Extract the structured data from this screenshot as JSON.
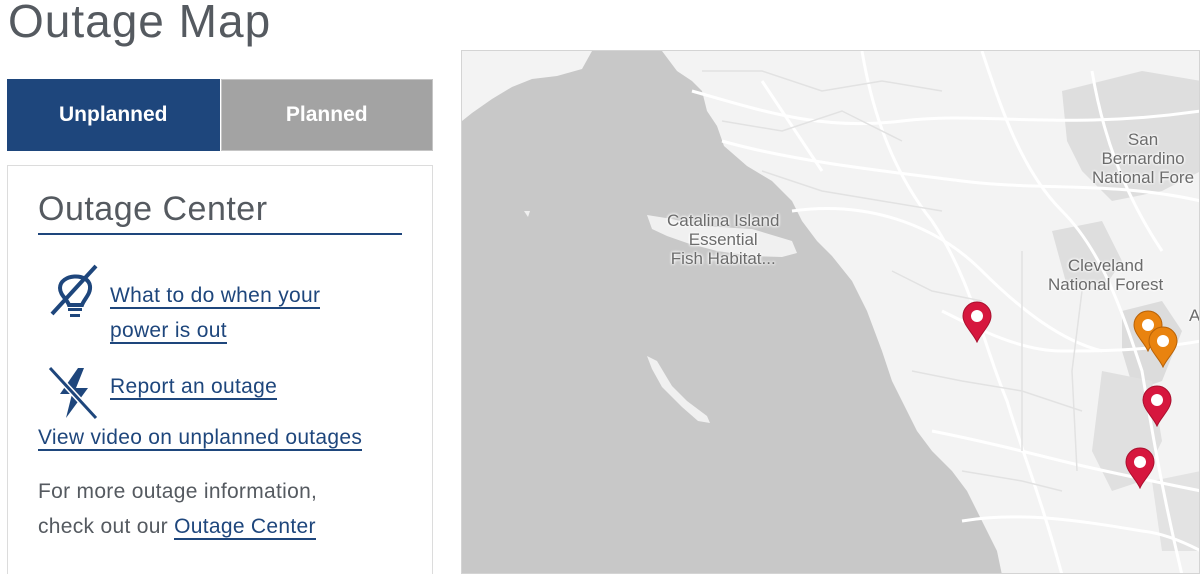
{
  "page": {
    "title": "Outage Map"
  },
  "tabs": [
    {
      "label": "Unplanned",
      "active": true
    },
    {
      "label": "Planned",
      "active": false
    }
  ],
  "outage_center": {
    "heading": "Outage Center",
    "links": {
      "power_out_line1": "What to do when your",
      "power_out_line2": "power is out",
      "report": "Report an outage",
      "video": "View video on unplanned outages"
    },
    "info_line1": "For more outage information,",
    "info_line2_prefix": "check out our ",
    "info_link": "Outage Center"
  },
  "map": {
    "labels": {
      "catalina_1": "Catalina Island",
      "catalina_2": "Essential",
      "catalina_3": "Fish Habitat...",
      "sb_1": "San",
      "sb_2": "Bernardino",
      "sb_3": "National Fore",
      "cleveland_1": "Cleveland",
      "cleveland_2": "National Forest",
      "cut_letter": "A"
    },
    "pin_colors": {
      "unplanned": "#d6173e",
      "planned": "#e9830f"
    },
    "icons": [
      "lightbulb-off-icon",
      "lightning-off-icon",
      "map-pin-icon"
    ]
  }
}
